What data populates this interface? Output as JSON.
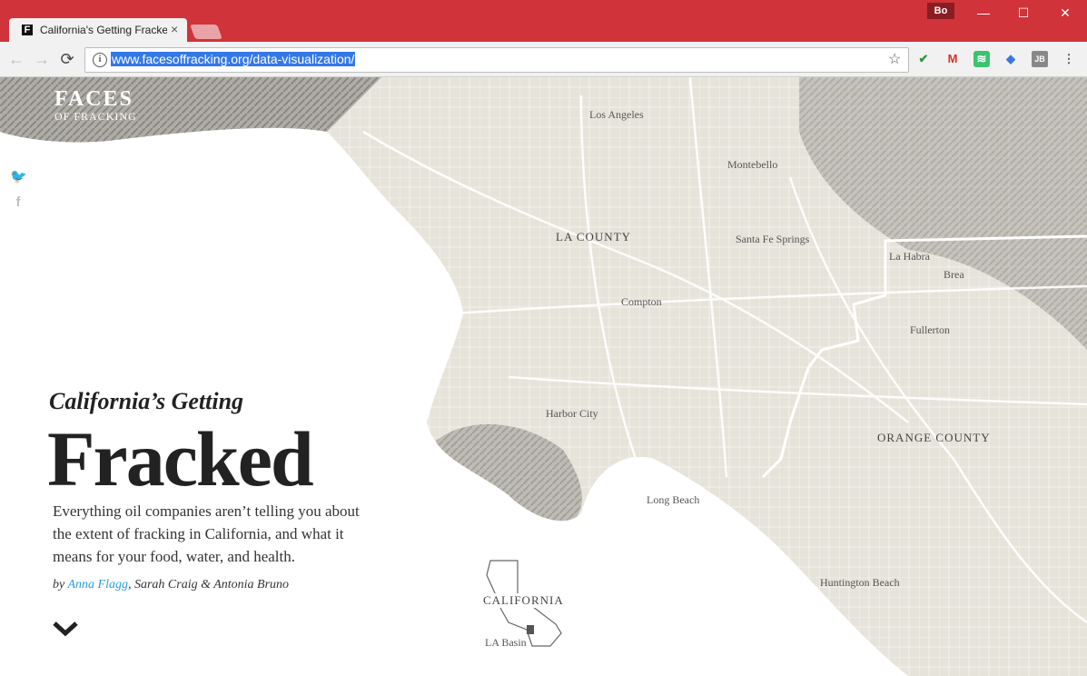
{
  "browser": {
    "tab_title": "California's Getting Fracked",
    "tab_favicon": "F",
    "url": "www.facesoffracking.org/data-visualization/",
    "profile": "Bo"
  },
  "page": {
    "logo_line1": "FACES",
    "logo_line2": "OF FRACKING",
    "kicker": "California’s Getting",
    "headline": "Fracked",
    "lede": "Everything oil companies aren’t telling you about the extent of fracking in California, and what it means for your food, water, and health.",
    "byline_prefix": "by ",
    "author_link": "Anna Flagg",
    "byline_rest": ", Sarah Craig & Antonia Bruno"
  },
  "map_labels": {
    "los_angeles": "Los Angeles",
    "montebello": "Montebello",
    "la_county": "LA COUNTY",
    "santa_fe_springs": "Santa Fe Springs",
    "la_habra": "La Habra",
    "brea": "Brea",
    "compton": "Compton",
    "fullerton": "Fullerton",
    "harbor_city": "Harbor City",
    "orange_county": "ORANGE COUNTY",
    "long_beach": "Long Beach",
    "huntington_beach": "Huntington Beach",
    "california": "CALIFORNIA",
    "la_basin": "LA Basin"
  },
  "colors": {
    "chrome_red": "#d0333a",
    "map_land": "#e6e3da",
    "link_blue": "#2a9fd6"
  }
}
